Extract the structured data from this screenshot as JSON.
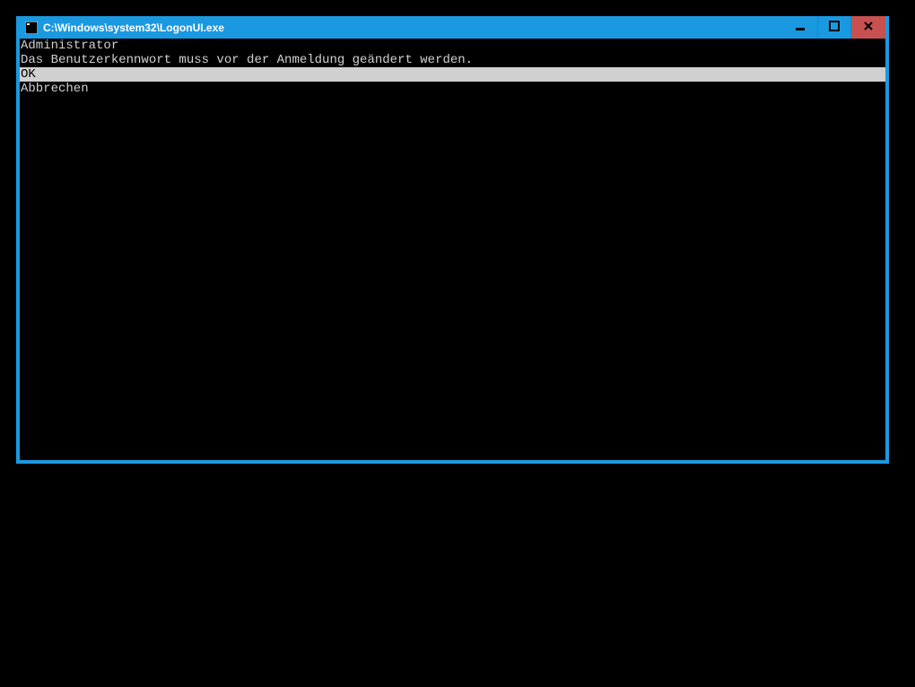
{
  "titlebar": {
    "title": "C:\\Windows\\system32\\LogonUI.exe"
  },
  "content": {
    "username": "Administrator",
    "message": "Das Benutzerkennwort muss vor der Anmeldung geändert werden.",
    "options": {
      "ok": "OK",
      "cancel": "Abbrechen"
    }
  }
}
